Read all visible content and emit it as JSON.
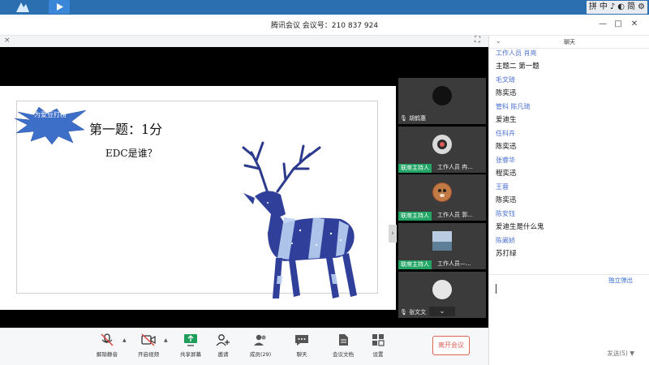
{
  "window": {
    "title": "腾讯会议  会议号：210 837 924",
    "minimize": "—",
    "restore": "□",
    "close": "✕"
  },
  "tray": {
    "items": [
      "拼",
      "中",
      "♪",
      "◐",
      "简",
      "⚙"
    ]
  },
  "meeting": {
    "close_glyph": "×",
    "expand_glyph": "⛶",
    "collapse_glyph": "›",
    "scroll_glyph": "⌄"
  },
  "slide": {
    "burst_text": "为爱豆打榜",
    "title": "第一题：1分",
    "question": "EDC是谁？"
  },
  "participants": [
    {
      "name": "胡鹤惠",
      "has_host_button": false
    },
    {
      "name": "工作人员 冉...",
      "has_host_button": true
    },
    {
      "name": "工作人员 郭...",
      "has_host_button": true
    },
    {
      "name": "工作人员—...",
      "has_host_button": true
    },
    {
      "name": "张文文",
      "has_host_button": false
    }
  ],
  "host_button_label": "联席主持人",
  "toolbar": {
    "items": [
      {
        "label": "解除静音",
        "icon": "muted-mic-icon"
      },
      {
        "label": "开启视频",
        "icon": "video-off-icon"
      },
      {
        "label": "共享屏幕",
        "icon": "share-screen-icon"
      },
      {
        "label": "邀请",
        "icon": "invite-icon"
      },
      {
        "label": "成员(29)",
        "icon": "members-icon"
      },
      {
        "label": "聊天",
        "icon": "chat-icon"
      },
      {
        "label": "会议文档",
        "icon": "document-icon"
      },
      {
        "label": "设置",
        "icon": "settings-icon"
      }
    ],
    "leave": "离开会议"
  },
  "chat": {
    "title": "聊天",
    "collapse": "⌄",
    "messages": [
      {
        "name": "工作人员 肖亮",
        "text": "主题二 第一题"
      },
      {
        "name": "毛文琦",
        "text": "陈奕迅"
      },
      {
        "name": "管科 陈凡琦",
        "text": "爱迪生"
      },
      {
        "name": "任科卉",
        "text": "陈奕迅"
      },
      {
        "name": "张睿华",
        "text": "程奕迅"
      },
      {
        "name": "王蓉",
        "text": "陈奕迅"
      },
      {
        "name": "陈安钰",
        "text": "爱迪生是什么鬼"
      },
      {
        "name": "陈阚娇",
        "text": "苏打绿"
      }
    ],
    "popout": "独立弹出",
    "send": "发送(S)  ▼"
  },
  "colors": {
    "accent": "#3a6fd8",
    "host_green": "#23a566",
    "leave_red": "#e0605a",
    "burst_blue": "#3d6fc9"
  }
}
